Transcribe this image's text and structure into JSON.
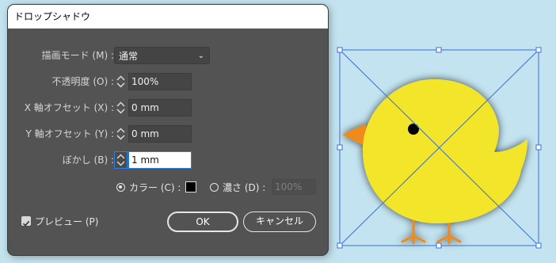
{
  "dialog": {
    "title": "ドロップシャドウ",
    "mode": {
      "label": "描画モード (M) :",
      "value": "通常"
    },
    "opacity": {
      "label": "不透明度 (O) :",
      "value": "100%"
    },
    "x_offset": {
      "label": "X 軸オフセット (X) :",
      "value": "0 mm"
    },
    "y_offset": {
      "label": "Y 軸オフセット (Y) :",
      "value": "0 mm"
    },
    "blur": {
      "label": "ぼかし (B) :",
      "value": "1 mm"
    },
    "color_option": {
      "label": "カラー (C) :",
      "selected": true,
      "swatch": "#000000"
    },
    "darkness_option": {
      "label": "濃さ (D) :",
      "selected": false,
      "value": "100%"
    },
    "preview": {
      "label": "プレビュー (P)",
      "checked": true
    },
    "ok_label": "OK",
    "cancel_label": "キャンセル"
  },
  "colors": {
    "canvas_bg": "#c2e3ef",
    "dialog_bg": "#535353",
    "chick_body": "#f2e52a",
    "chick_beak": "#f08a1c",
    "chick_feet": "#f08a1c",
    "selection": "#3a6fd8"
  }
}
